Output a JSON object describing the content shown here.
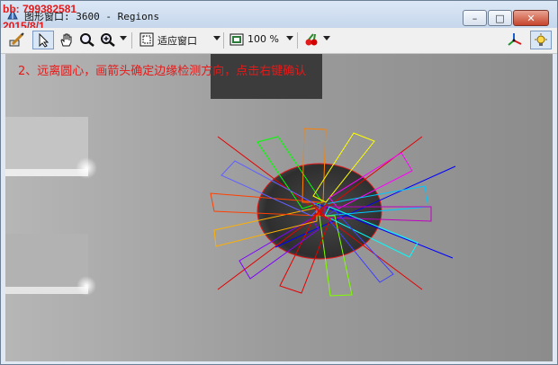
{
  "watermark": {
    "line1": "bb: 799382581",
    "line2": "2015/8/1"
  },
  "window": {
    "title": "图形窗口: 3600 - Regions",
    "minimize_glyph": "–",
    "maximize_glyph": "□",
    "close_glyph": "✕"
  },
  "toolbar": {
    "fit_label": "适应窗口",
    "zoom_value": "100 %",
    "tools": [
      "draw-icon",
      "pointer-icon",
      "pan-hand-icon",
      "magnifier-icon",
      "zoom-in-icon",
      "fit-window-icon",
      "zoom-level-icon",
      "color-paint-icon",
      "axes-icon",
      "settings-icon"
    ]
  },
  "image": {
    "instruction": "2、远离圆心，画箭头确定边缘检测方向，点击右键确认"
  },
  "colors": {
    "watermark": "#e31a1a",
    "instruction": "#e31a1a",
    "rays": [
      "#e60000",
      "#0000ff",
      "#00c8ff",
      "#ffff00",
      "#00ff00",
      "#ff00ff",
      "#ff8000",
      "#8000ff"
    ]
  }
}
